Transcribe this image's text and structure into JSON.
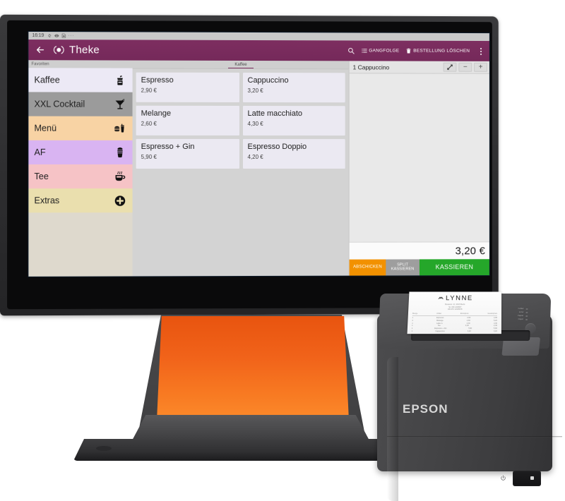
{
  "statusbar": {
    "time": "16:19",
    "icons": [
      "sync-icon",
      "eye-icon",
      "sim-card-icon"
    ],
    "overflow": "···"
  },
  "appbar": {
    "back_icon": "back-arrow-icon",
    "logo_icon": "app-logo-icon",
    "title": "Theke",
    "search_icon": "search-icon",
    "course_icon": "list-icon",
    "course_label": "GANGFOLGE",
    "delete_icon": "trash-icon",
    "delete_label": "BESTELLUNG LÖSCHEN",
    "overflow_icon": "kebab-menu-icon"
  },
  "sidebar": {
    "header": "Favoriten",
    "items": [
      {
        "label": "Kaffee",
        "color": "#ece9f5",
        "icon": "coffee-grinder-icon",
        "selected": false
      },
      {
        "label": "XXL Cocktail",
        "color": "#9b9b9b",
        "icon": "cocktail-glass-icon",
        "selected": true
      },
      {
        "label": "Menü",
        "color": "#f8d3a4",
        "icon": "burger-drink-icon",
        "selected": false
      },
      {
        "label": "AF",
        "color": "#d9b4f2",
        "icon": "milkshake-icon",
        "selected": false
      },
      {
        "label": "Tee",
        "color": "#f6c3c6",
        "icon": "tea-cup-icon",
        "selected": false
      },
      {
        "label": "Extras",
        "color": "#eadfae",
        "icon": "plus-circle-icon",
        "selected": false
      }
    ]
  },
  "products": {
    "active_tab": "Kaffee",
    "tabs": [
      "Kaffee"
    ],
    "items": [
      {
        "name": "Espresso",
        "price": "2,90 €"
      },
      {
        "name": "Cappuccino",
        "price": "3,20 €"
      },
      {
        "name": "Melange",
        "price": "2,60 €"
      },
      {
        "name": "Latte macchiato",
        "price": "4,30 €"
      },
      {
        "name": "Espresso + Gin",
        "price": "5,90 €"
      },
      {
        "name": "Espresso Doppio",
        "price": "4,20 €"
      }
    ]
  },
  "order": {
    "line_item": "1 Cappuccino",
    "expand_icon": "expand-diagonal-icon",
    "minus_label": "−",
    "plus_label": "+",
    "total": "3,20 €",
    "actions": [
      {
        "label": "ABSCHICKEN",
        "color": "#f29100"
      },
      {
        "label_line1": "SPLIT",
        "label_line2": "KASSIEREN",
        "color": "#9e9e9e"
      },
      {
        "label": "KASSIEREN",
        "color": "#25a72a"
      }
    ]
  },
  "hardware": {
    "stand_color": "#f1631a",
    "printer_brand": "EPSON",
    "power_icon": "power-icon"
  },
  "receipt": {
    "logo_icon": "lynne-logo-icon",
    "logo_text": "LYNNE",
    "subtitle_lines": [
      "Musterstr. 12, 10115 Berlin",
      "Tel. 030 1234567",
      "UID ATU 12345678"
    ],
    "columns": [
      "Menge",
      "Artikel",
      "Einzelpreis",
      "Gesamtpreis"
    ],
    "rows": [
      {
        "qty": "1",
        "item": "Espresso",
        "unit": "2,90",
        "total": "2,90"
      },
      {
        "qty": "2",
        "item": "Melange",
        "unit": "2,60",
        "total": "5,20"
      },
      {
        "qty": "1",
        "item": "Latte m.",
        "unit": "4,30",
        "total": "4,30"
      },
      {
        "qty": "1",
        "item": "Tee",
        "unit": "2,40",
        "total": "2,40"
      },
      {
        "qty": "1",
        "item": "Espresso + Gin",
        "unit": "5,90",
        "total": "5,90"
      },
      {
        "qty": "1",
        "item": "Cappuccino",
        "unit": "3,20",
        "total": "3,20"
      }
    ]
  },
  "printer_panel": {
    "leds": [
      "Fehler",
      "Error",
      "Papier",
      "Paper"
    ]
  }
}
